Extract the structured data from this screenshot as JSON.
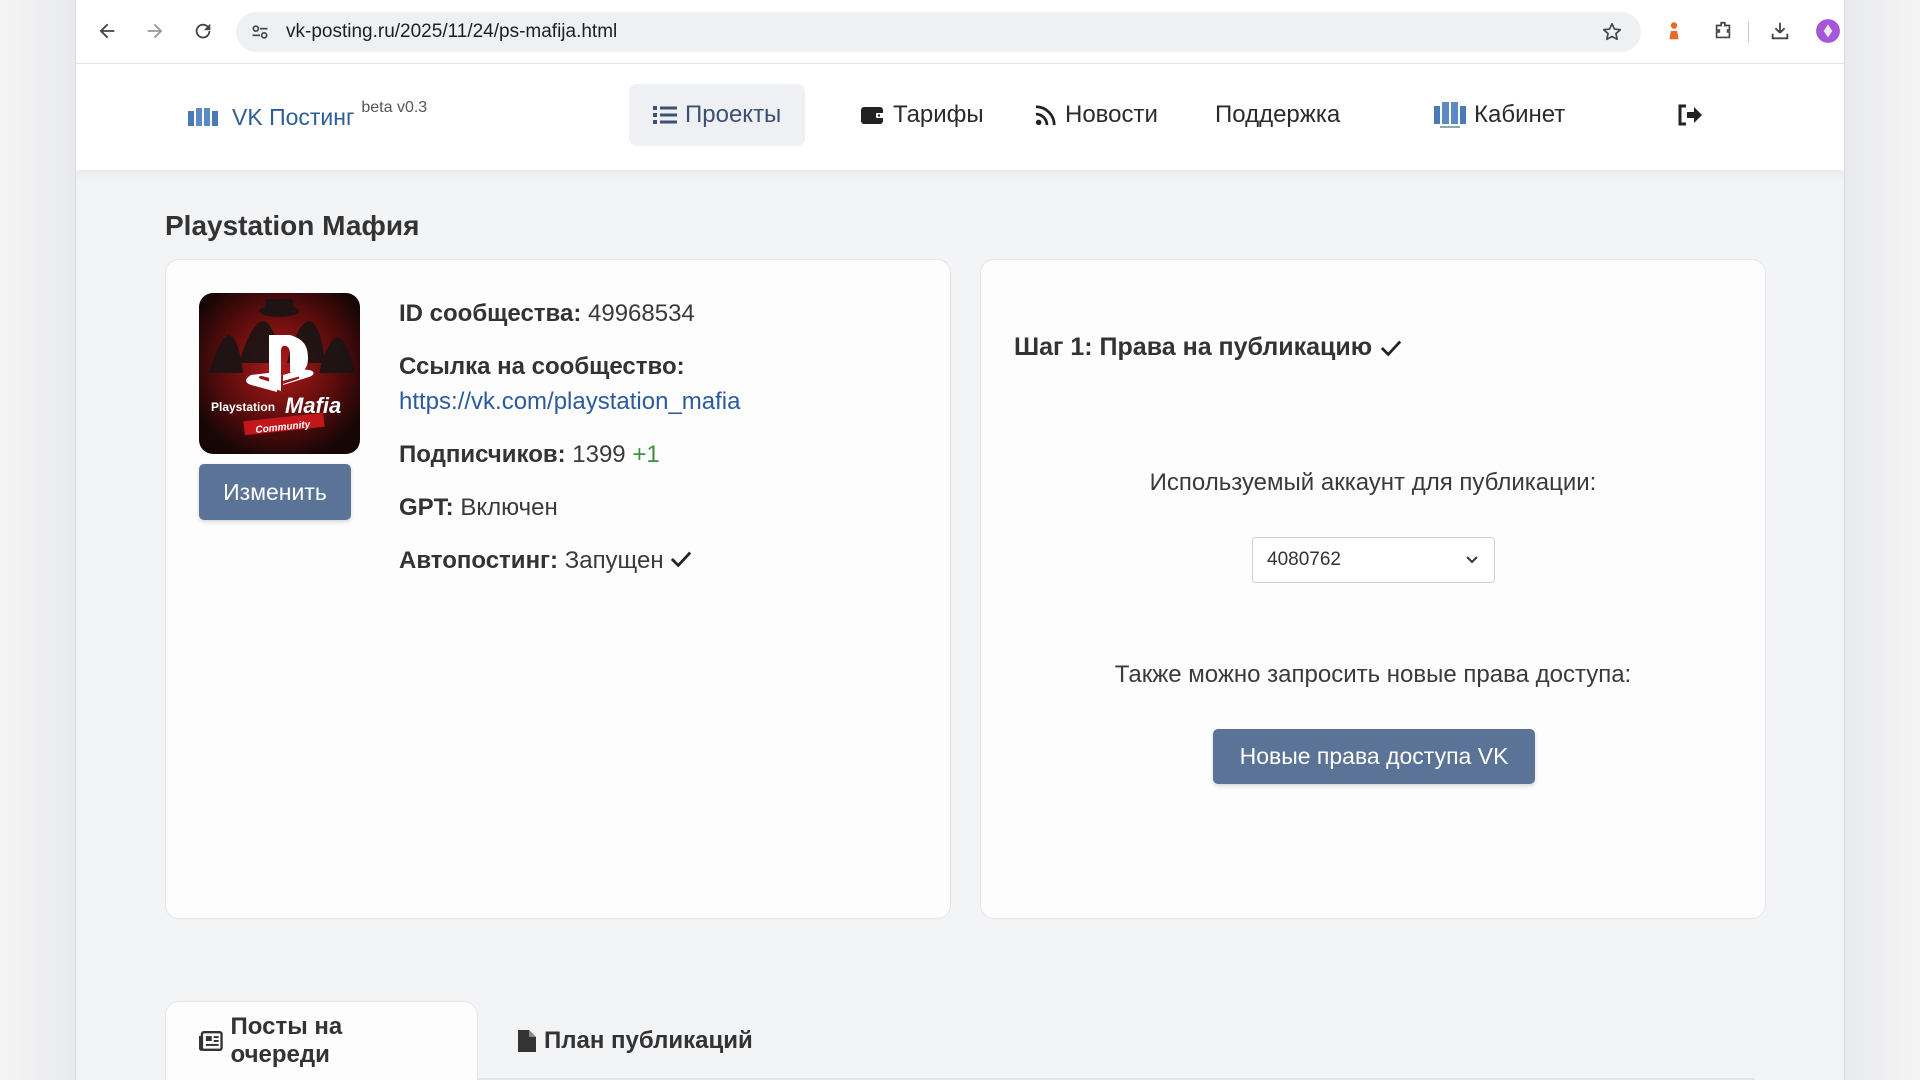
{
  "browser": {
    "url": "vk-posting.ru/2025/11/24/ps-mafija.html"
  },
  "site": {
    "brand_name": "VK Постинг",
    "brand_beta": "beta v0.3",
    "nav": {
      "projects": "Проекты",
      "tariffs": "Тарифы",
      "news": "Новости",
      "support": "Поддержка",
      "cabinet": "Кабинет"
    }
  },
  "page": {
    "title": "Playstation Мафия"
  },
  "community": {
    "avatar_text_line1": "Playstation",
    "avatar_text_line2": "Mafia",
    "avatar_text_line3": "Community",
    "edit_label": "Изменить",
    "id_label": "ID сообщества:",
    "id_value": "49968534",
    "link_label": "Ссылка на сообщество:",
    "link_value": "https://vk.com/playstation_mafia",
    "subscribers_label": "Подписчиков:",
    "subscribers_value": "1399",
    "subscribers_delta": "+1",
    "gpt_label": "GPT:",
    "gpt_value": "Включен",
    "autopost_label": "Автопостинг:",
    "autopost_value": "Запущен"
  },
  "step": {
    "title": "Шаг 1: Права на публикацию",
    "account_label": "Используемый аккаунт для публикации:",
    "account_selected": "4080762",
    "request_label": "Также можно запросить новые права доступа:",
    "request_button": "Новые права доступа VK"
  },
  "tabs": {
    "queue": "Посты на очереди",
    "plan": "План публикаций"
  },
  "colors": {
    "accent": "#5a7396",
    "brand": "#2c5f96",
    "link": "#2c5aa0",
    "positive": "#3f8f3f"
  }
}
